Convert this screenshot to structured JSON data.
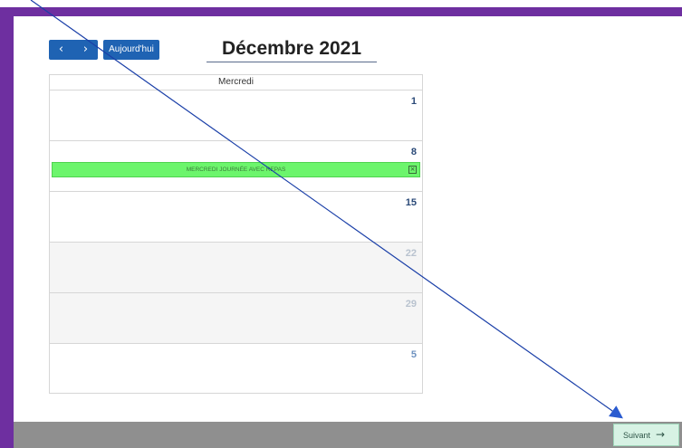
{
  "toolbar": {
    "prev_icon": "‹",
    "next_icon": "›",
    "today_label": "Aujourd'hui"
  },
  "calendar": {
    "title": "Décembre 2021",
    "column_header": "Mercredi",
    "weeks": [
      {
        "day": "1"
      },
      {
        "day": "8",
        "event": {
          "label": "MERCREDI JOURNÉE AVEC REPAS",
          "close": "×"
        }
      },
      {
        "day": "15"
      },
      {
        "day": "22"
      },
      {
        "day": "29"
      },
      {
        "day": "5"
      }
    ]
  },
  "footer": {
    "next_label": "Suivant",
    "next_arrow": "→"
  },
  "colors": {
    "frame_border": "#6e2fa0",
    "primary_button": "#1f63b3",
    "event_bg": "#6cf56c",
    "footer_bg": "#8f8f8f",
    "annotation_line": "#1a3fa8"
  },
  "icons": {
    "prev": "chevron-left-icon",
    "next": "chevron-right-icon",
    "event_close": "close-icon",
    "footer_next": "arrow-right-icon"
  }
}
